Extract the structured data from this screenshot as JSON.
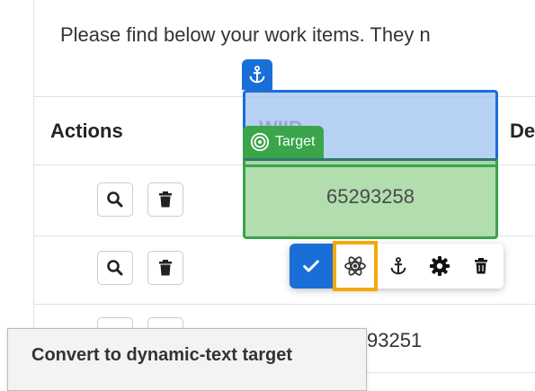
{
  "intro_text": "Please find below your work items. They n",
  "table": {
    "headers": {
      "actions": "Actions",
      "wiid": "WIID",
      "description": "De"
    },
    "partial_cell": "93251"
  },
  "overlay": {
    "target_label": "Target",
    "target_value": "65293258"
  },
  "toolbar": {
    "items": [
      "check-icon",
      "atom-icon",
      "anchor-icon",
      "gear-icon",
      "trash-icon"
    ]
  },
  "tooltip": {
    "text": "Convert to dynamic-text target"
  },
  "colors": {
    "blue": "#1a6ed8",
    "green": "#3aa54a",
    "highlight": "#f5a80a"
  }
}
